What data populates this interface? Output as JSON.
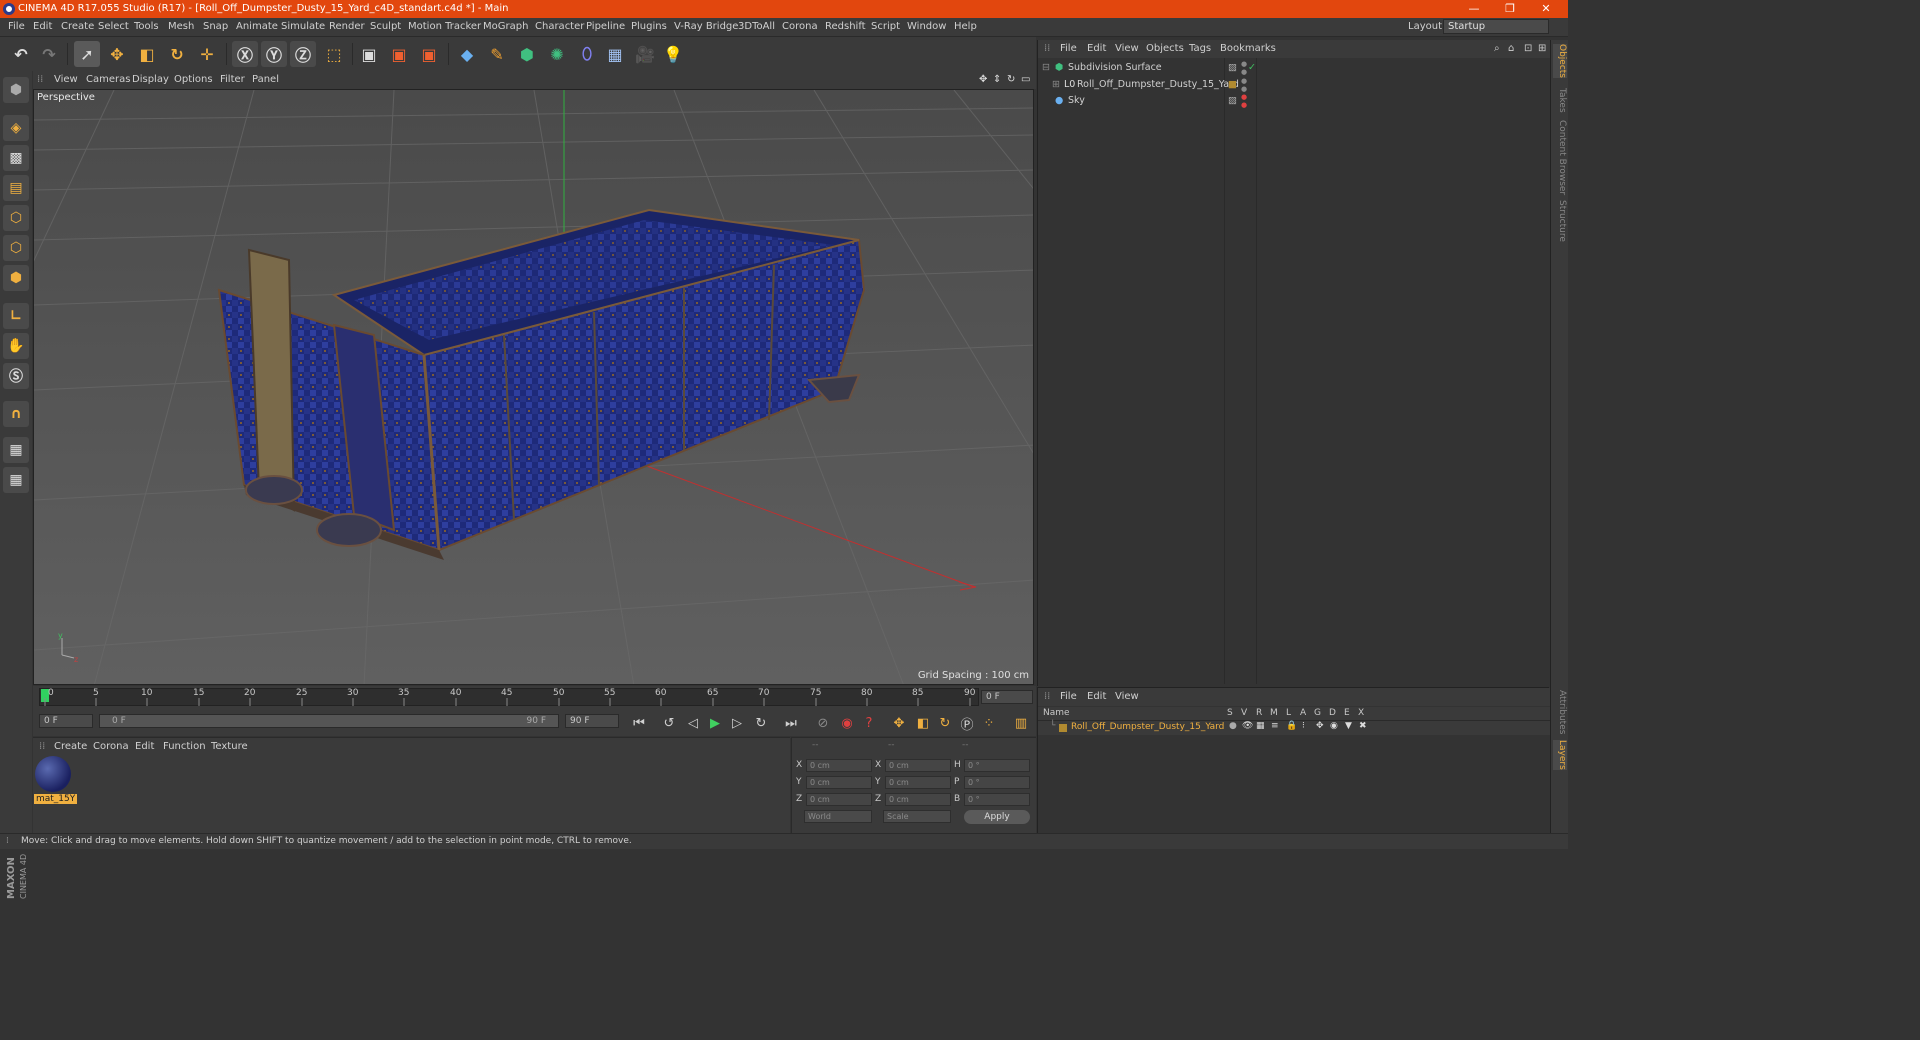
{
  "window": {
    "title": "CINEMA 4D R17.055 Studio (R17) - [Roll_Off_Dumpster_Dusty_15_Yard_c4D_standart.c4d *] - Main",
    "minimize": "—",
    "restore": "❐",
    "close": "✕"
  },
  "menu": [
    "File",
    "Edit",
    "Create",
    "Select",
    "Tools",
    "Mesh",
    "Snap",
    "Animate",
    "Simulate",
    "Render",
    "Sculpt",
    "Motion Tracker",
    "MoGraph",
    "Character",
    "Pipeline",
    "Plugins",
    "V-Ray Bridge",
    "3DToAll",
    "Corona",
    "Redshift",
    "Script",
    "Window",
    "Help"
  ],
  "layout": {
    "label": "Layout:",
    "value": "Startup"
  },
  "viewport": {
    "menu": [
      "View",
      "Cameras",
      "Display",
      "Options",
      "Filter",
      "Panel"
    ],
    "name": "Perspective",
    "grid_spacing": "Grid Spacing : 100 cm"
  },
  "timeline": {
    "ticks": [
      "0",
      "5",
      "10",
      "15",
      "20",
      "25",
      "30",
      "35",
      "40",
      "45",
      "50",
      "55",
      "60",
      "65",
      "70",
      "75",
      "80",
      "85",
      "90"
    ],
    "current_frame_field": "0 F",
    "start": "0 F",
    "range_start": "0 F",
    "range_end": "90 F",
    "end": "90 F"
  },
  "material_panel": {
    "menu": [
      "Create",
      "Corona",
      "Edit",
      "Function",
      "Texture"
    ],
    "material_name": "mat_15Y"
  },
  "coords": {
    "headers": [
      "--",
      "--",
      "--"
    ],
    "rows": [
      {
        "a": "X",
        "av": "0 cm",
        "b": "X",
        "bv": "0 cm",
        "c": "H",
        "cv": "0 °"
      },
      {
        "a": "Y",
        "av": "0 cm",
        "b": "Y",
        "bv": "0 cm",
        "c": "P",
        "cv": "0 °"
      },
      {
        "a": "Z",
        "av": "0 cm",
        "b": "Z",
        "bv": "0 cm",
        "c": "B",
        "cv": "0 °"
      }
    ],
    "mode": "World",
    "scale": "Scale",
    "apply": "Apply"
  },
  "objects_panel": {
    "menu": [
      "File",
      "Edit",
      "View",
      "Objects",
      "Tags",
      "Bookmarks"
    ],
    "items": [
      {
        "name": "Subdivision Surface",
        "indent": 0
      },
      {
        "name": "Roll_Off_Dumpster_Dusty_15_Yard",
        "indent": 1
      },
      {
        "name": "Sky",
        "indent": 0
      }
    ]
  },
  "layers_panel": {
    "menu": [
      "File",
      "Edit",
      "View"
    ],
    "columns": [
      "Name",
      "S",
      "V",
      "R",
      "M",
      "L",
      "A",
      "G",
      "D",
      "E",
      "X"
    ],
    "layer_name": "Roll_Off_Dumpster_Dusty_15_Yard"
  },
  "side_tabs": [
    "Objects",
    "Takes",
    "Content Browser",
    "Structure",
    "Attributes",
    "Layers"
  ],
  "status": "Move: Click and drag to move elements. Hold down SHIFT to quantize movement / add to the selection in point mode, CTRL to remove.",
  "maxon": "MAXON",
  "cinema": "CINEMA 4D",
  "colors": {
    "accent": "#e2470e",
    "object_orange": "#f0b040"
  }
}
